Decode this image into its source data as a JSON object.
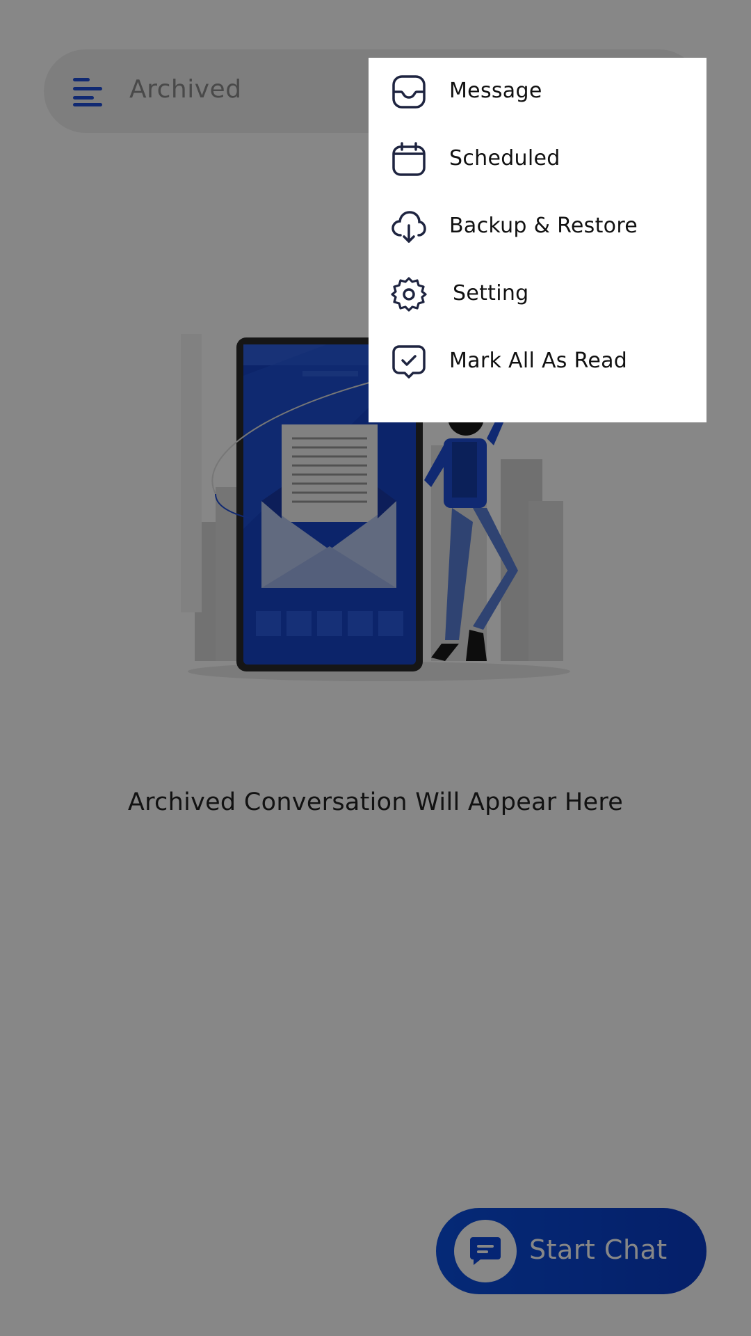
{
  "header": {
    "title": "Archived",
    "menu_icon": "menu-icon"
  },
  "empty_state": {
    "message": "Archived Conversation Will Appear Here",
    "illustration": "phone-envelope-illustration"
  },
  "fab": {
    "label": "Start Chat",
    "icon": "chat-bubble-icon"
  },
  "popup_menu": {
    "items": [
      {
        "label": "Message",
        "icon": "inbox-icon"
      },
      {
        "label": "Scheduled",
        "icon": "calendar-icon"
      },
      {
        "label": "Backup & Restore",
        "icon": "cloud-download-icon"
      },
      {
        "label": "Setting",
        "icon": "gear-icon"
      },
      {
        "label": "Mark All As Read",
        "icon": "chat-check-icon"
      }
    ]
  },
  "colors": {
    "accent": "#0A47DB",
    "scrim": "#000000",
    "icon_dark": "#1E2440"
  }
}
